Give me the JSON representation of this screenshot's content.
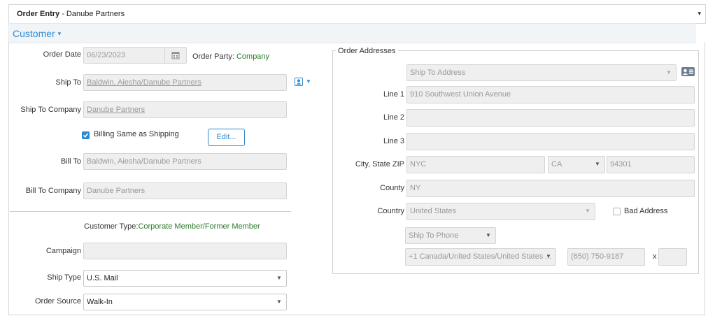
{
  "header": {
    "title_bold": "Order Entry",
    "title_rest": " - Danube Partners",
    "caret": "▾"
  },
  "section": {
    "label": "Customer",
    "caret": "▾"
  },
  "colors": {
    "accent": "#2f8ad0",
    "green_text": "#2a7a2a",
    "field_bg": "#efefef"
  },
  "order": {
    "order_date_label": "Order Date",
    "order_date_value": "06/23/2023",
    "calendar_icon": "calendar-icon",
    "order_party_label": "Order Party: ",
    "order_party_value": "Company",
    "ship_to_label": "Ship To",
    "ship_to_value": "Baldwin, Aiesha/Danube Partners",
    "ship_to_company_label": "Ship To Company",
    "ship_to_company_value": "Danube Partners",
    "billing_same_label": "Billing Same as Shipping",
    "billing_same_checked": true,
    "edit_button": "Edit...",
    "bill_to_label": "Bill To",
    "bill_to_value": "Baldwin, Aiesha/Danube Partners",
    "bill_to_company_label": "Bill To Company",
    "bill_to_company_value": "Danube Partners",
    "customer_type_label": "Customer Type:",
    "customer_type_value": "Corporate Member/Former Member",
    "campaign_label": "Campaign",
    "campaign_value": "",
    "ship_type_label": "Ship Type",
    "ship_type_value": "U.S. Mail",
    "order_source_label": "Order Source",
    "order_source_value": "Walk-In"
  },
  "addresses": {
    "legend": "Order Addresses",
    "ship_to_address": "Ship To Address",
    "line1_label": "Line 1",
    "line1_value": "910 Southwest Union Avenue",
    "line2_label": "Line 2",
    "line2_value": "",
    "line3_label": "Line 3",
    "line3_value": "",
    "city_state_zip_label": "City, State ZIP",
    "city_value": "NYC",
    "state_value": "CA",
    "zip_value": "94301",
    "county_label": "County",
    "county_value": "NY",
    "country_label": "Country",
    "country_value": "United States",
    "bad_address_label": "Bad Address",
    "bad_address_checked": false,
    "phone_type": "Ship To Phone",
    "phone_country": "+1 Canada/United States/United States ...",
    "phone_number": "(650) 750-9187",
    "ext_label": "x",
    "ext_value": ""
  }
}
